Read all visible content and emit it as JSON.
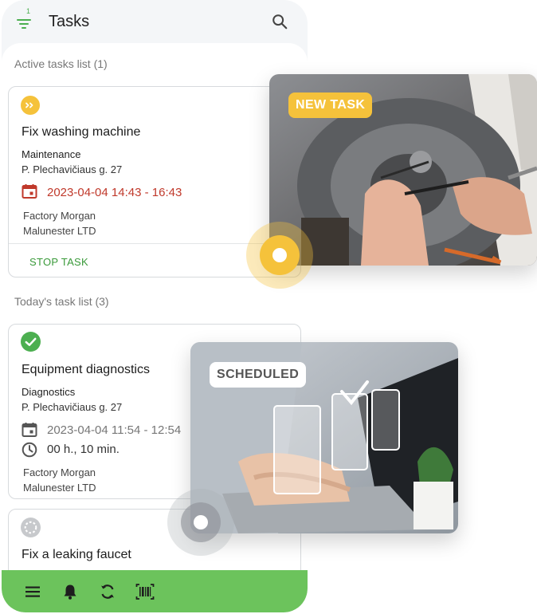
{
  "app": {
    "title": "Tasks",
    "filter_count": "1"
  },
  "sections": {
    "active": "Active tasks list (1)",
    "today": "Today's task list (3)"
  },
  "active_task": {
    "title": "Fix washing machine",
    "category": "Maintenance",
    "address": "P. Plechavičiaus g. 27",
    "datetime": "2023-04-04 14:43 - 16:43",
    "company": "Factory Morgan",
    "client": "Malunester LTD",
    "action": "STOP TASK"
  },
  "today_tasks": [
    {
      "title": "Equipment diagnostics",
      "category": "Diagnostics",
      "address": "P. Plechavičiaus g. 27",
      "datetime": "2023-04-04 11:54 - 12:54",
      "duration": "00 h., 10 min.",
      "company": "Factory Morgan",
      "client": "Malunester LTD"
    },
    {
      "title": "Fix a leaking faucet"
    }
  ],
  "badges": {
    "new_task": "NEW TASK",
    "scheduled": "SCHEDULED"
  },
  "colors": {
    "accent_green": "#6cc35c",
    "active_date_red": "#c0392b",
    "badge_yellow": "#f5c23b",
    "status_done_green": "#4caf50"
  },
  "icons": {
    "filter": "filter-icon",
    "search": "search-icon",
    "status_active": "arrow-right-circle-icon",
    "status_done": "check-circle-icon",
    "status_pending": "dashed-circle-icon",
    "nav": [
      "menu-icon",
      "bell-icon",
      "sync-icon",
      "barcode-icon"
    ]
  }
}
